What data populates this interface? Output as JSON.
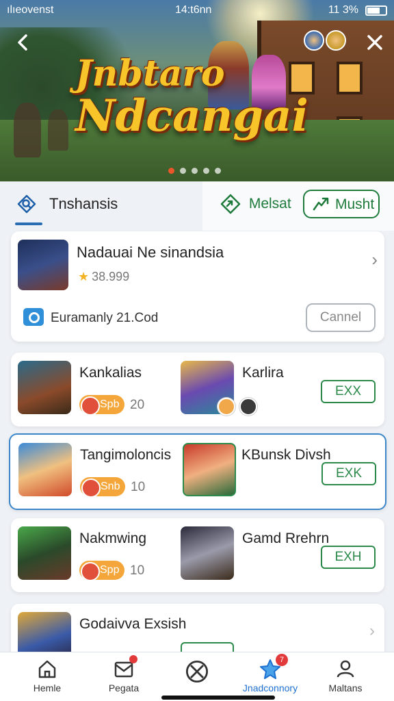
{
  "status_bar": {
    "carrier": "ılıeovenst",
    "time": "14:t6nn",
    "battery": "11 3%"
  },
  "banner": {
    "title_line1": "Jnbtaro",
    "title_line2": "Ndcangai",
    "carousel_dots": 5,
    "active_dot": 0
  },
  "tabs": {
    "search_label": "Tnshansis",
    "melsat_label": "Melsat",
    "musht_label": "Musht"
  },
  "feature_card": {
    "name": "Nadauai Ne sinandsia",
    "rating": "38.999",
    "info_text": "Euramanly 21.Cod",
    "cancel_label": "Cannel"
  },
  "rows": [
    {
      "name1": "Kankalias",
      "name2": "Karlira",
      "badge": "Spb",
      "count": "20",
      "button": "EXX"
    },
    {
      "name1": "Tangimoloncis",
      "name2": "KBunsk Divsh",
      "badge": "Snb",
      "count": "10",
      "button": "EXK"
    },
    {
      "name1": "Nakmwing",
      "name2": "Gamd Rrehrn",
      "badge": "Spp",
      "count": "10",
      "button": "EXH"
    },
    {
      "name1": "Godaivva Exsish"
    }
  ],
  "bottom_nav": [
    {
      "label": "Hemle",
      "icon": "home-icon"
    },
    {
      "label": "Pegata",
      "icon": "mail-icon"
    },
    {
      "label": "",
      "icon": "ball-icon"
    },
    {
      "label": "Jnadconnory",
      "icon": "star-icon",
      "badge": "7"
    },
    {
      "label": "Maltans",
      "icon": "person-icon"
    }
  ],
  "colors": {
    "accent_blue": "#2a6db3",
    "accent_green": "#1d7a3a",
    "badge_orange": "#f4a63a",
    "title_gold": "#f7c52a"
  }
}
